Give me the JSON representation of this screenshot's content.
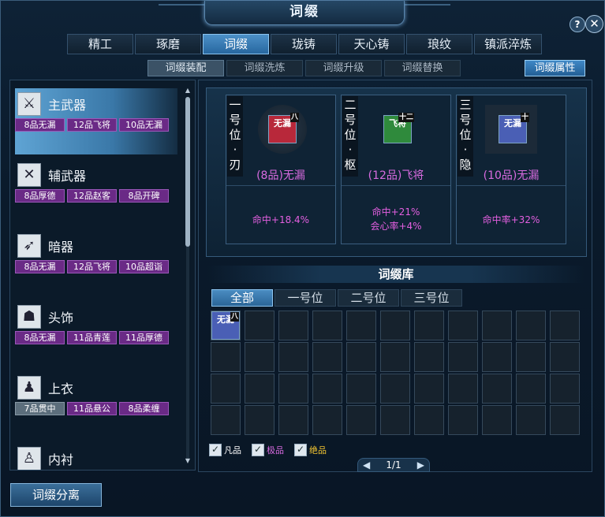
{
  "window": {
    "title": "词缀",
    "help": "?",
    "close": "✕"
  },
  "main_tabs": [
    "精工",
    "琢磨",
    "词缀",
    "珑铸",
    "天心铸",
    "琅纹",
    "镇派淬炼"
  ],
  "sub_tabs": [
    "词缀装配",
    "词缀洗炼",
    "词缀升级",
    "词缀替换"
  ],
  "attr_button": "词缀属性",
  "equipment": [
    {
      "name": "主武器",
      "icon": "sword-icon",
      "tags": [
        "8品无漏",
        "12品飞将",
        "10品无漏"
      ]
    },
    {
      "name": "辅武器",
      "icon": "crossed-blades-icon",
      "tags": [
        "8品厚德",
        "12品赵客",
        "8品开碑"
      ]
    },
    {
      "name": "暗器",
      "icon": "dagger-icon",
      "tags": [
        "8品无漏",
        "12品飞将",
        "10品超诣"
      ]
    },
    {
      "name": "头饰",
      "icon": "helmet-icon",
      "tags": [
        "8品无漏",
        "11品青莲",
        "11品厚德"
      ]
    },
    {
      "name": "上衣",
      "icon": "robe-icon",
      "tags": [
        "7品贯中",
        "11品悬公",
        "8品柔缠"
      ]
    },
    {
      "name": "内衬",
      "icon": "shirt-icon",
      "tags": []
    }
  ],
  "split_button": "词缀分离",
  "slots": [
    {
      "banner": [
        "一",
        "号",
        "位",
        "·",
        "刃"
      ],
      "affix_text": "无漏",
      "badge": "八",
      "name": "(8品)无漏",
      "stats": [
        "命中+18.4%"
      ],
      "color": "#b8283a"
    },
    {
      "banner": [
        "二",
        "号",
        "位",
        "·",
        "枢"
      ],
      "affix_text": "飞将",
      "badge": "十二",
      "name": "(12品)飞将",
      "stats": [
        "命中+21%",
        "会心率+4%"
      ],
      "color": "#2f8a3c"
    },
    {
      "banner": [
        "三",
        "号",
        "位",
        "·",
        "隐"
      ],
      "affix_text": "无漏",
      "badge": "十",
      "name": "(10品)无漏",
      "stats": [
        "命中率+32%"
      ],
      "color": "#4a5fb5"
    }
  ],
  "library": {
    "title": "词缀库",
    "tabs": [
      "全部",
      "一号位",
      "二号位",
      "三号位"
    ],
    "first_item": {
      "text": "无漏",
      "badge": "八"
    },
    "legend": [
      {
        "label": "凡品",
        "color": "#ffffff"
      },
      {
        "label": "极品",
        "color": "#d86be0"
      },
      {
        "label": "绝品",
        "color": "#f2c531"
      }
    ],
    "pager": "1/1"
  }
}
